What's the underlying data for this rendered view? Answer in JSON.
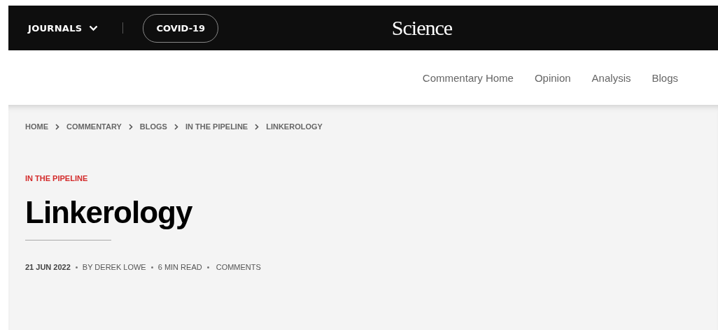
{
  "top_bar": {
    "journals_menu": {
      "label": "JOURNALS"
    },
    "covid_link": {
      "label": "COVID-19"
    },
    "logo": "Science"
  },
  "sub_nav": {
    "items": [
      "Commentary Home",
      "Opinion",
      "Analysis",
      "Blogs"
    ]
  },
  "breadcrumb": [
    "HOME",
    "COMMENTARY",
    "BLOGS",
    "IN THE PIPELINE",
    "LINKEROLOGY"
  ],
  "article": {
    "section": "IN THE PIPELINE",
    "title": "Linkerology",
    "meta": [
      {
        "kind": "date",
        "text": "21 JUN 2022"
      },
      {
        "kind": "byline",
        "text": "BY DEREK LOWE"
      },
      {
        "kind": "plain",
        "text": "6 MIN READ"
      },
      {
        "kind": "link",
        "text": "COMMENTS"
      }
    ]
  }
}
